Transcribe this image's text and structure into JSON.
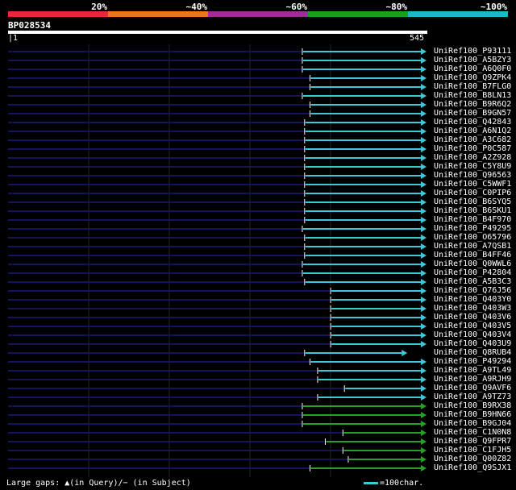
{
  "legend": [
    {
      "label": "20%",
      "color": "#e8283a"
    },
    {
      "label": "~40%",
      "color": "#e8781e"
    },
    {
      "label": "~60%",
      "color": "#9b2e9a"
    },
    {
      "label": "~80%",
      "color": "#1aa01a"
    },
    {
      "label": "~100%",
      "color": "#1ab8c8"
    }
  ],
  "query": {
    "id": "BP028534",
    "start_label": "1",
    "end_label": "545",
    "length": 545
  },
  "colors": {
    "query_gap": "#14145a",
    "cyan": "#3cc8d8",
    "green": "#28a028",
    "grid": "#242424"
  },
  "hits": [
    {
      "label": "UniRef100_P93111",
      "start": 385,
      "end": 545,
      "color": "cyan"
    },
    {
      "label": "UniRef100_A5BZY3",
      "start": 385,
      "end": 545,
      "color": "cyan"
    },
    {
      "label": "UniRef100_A6Q0F0",
      "start": 385,
      "end": 545,
      "color": "cyan"
    },
    {
      "label": "UniRef100_Q9ZPK4",
      "start": 395,
      "end": 545,
      "color": "cyan"
    },
    {
      "label": "UniRef100_B7FLG0",
      "start": 395,
      "end": 545,
      "color": "cyan"
    },
    {
      "label": "UniRef100_B8LN13",
      "start": 385,
      "end": 545,
      "color": "cyan"
    },
    {
      "label": "UniRef100_B9R6Q2",
      "start": 395,
      "end": 545,
      "color": "cyan"
    },
    {
      "label": "UniRef100_B9GN57",
      "start": 395,
      "end": 545,
      "color": "cyan"
    },
    {
      "label": "UniRef100_Q42843",
      "start": 388,
      "end": 545,
      "color": "cyan"
    },
    {
      "label": "UniRef100_A6N1Q2",
      "start": 388,
      "end": 545,
      "color": "cyan"
    },
    {
      "label": "UniRef100_A3C682",
      "start": 388,
      "end": 545,
      "color": "cyan"
    },
    {
      "label": "UniRef100_P0C587",
      "start": 388,
      "end": 545,
      "color": "cyan"
    },
    {
      "label": "UniRef100_A2Z928",
      "start": 388,
      "end": 545,
      "color": "cyan"
    },
    {
      "label": "UniRef100_C5Y8U9",
      "start": 388,
      "end": 545,
      "color": "cyan"
    },
    {
      "label": "UniRef100_Q96563",
      "start": 388,
      "end": 545,
      "color": "cyan"
    },
    {
      "label": "UniRef100_C5WWF1",
      "start": 388,
      "end": 545,
      "color": "cyan"
    },
    {
      "label": "UniRef100_C0PIP6",
      "start": 388,
      "end": 545,
      "color": "cyan"
    },
    {
      "label": "UniRef100_B6SYQ5",
      "start": 388,
      "end": 545,
      "color": "cyan"
    },
    {
      "label": "UniRef100_B6SKU1",
      "start": 388,
      "end": 545,
      "color": "cyan"
    },
    {
      "label": "UniRef100_B4F970",
      "start": 388,
      "end": 545,
      "color": "cyan"
    },
    {
      "label": "UniRef100_P49295",
      "start": 385,
      "end": 545,
      "color": "cyan"
    },
    {
      "label": "UniRef100_O65796",
      "start": 388,
      "end": 545,
      "color": "cyan"
    },
    {
      "label": "UniRef100_A7QSB1",
      "start": 388,
      "end": 545,
      "color": "cyan"
    },
    {
      "label": "UniRef100_B4FF46",
      "start": 388,
      "end": 545,
      "color": "cyan"
    },
    {
      "label": "UniRef100_Q0WWL6",
      "start": 385,
      "end": 545,
      "color": "cyan"
    },
    {
      "label": "UniRef100_P42804",
      "start": 385,
      "end": 545,
      "color": "cyan"
    },
    {
      "label": "UniRef100_A5B3C3",
      "start": 388,
      "end": 545,
      "color": "cyan"
    },
    {
      "label": "UniRef100_Q76J56",
      "start": 422,
      "end": 545,
      "color": "cyan"
    },
    {
      "label": "UniRef100_Q403Y0",
      "start": 422,
      "end": 545,
      "color": "cyan"
    },
    {
      "label": "UniRef100_Q403W3",
      "start": 422,
      "end": 545,
      "color": "cyan"
    },
    {
      "label": "UniRef100_Q403V6",
      "start": 422,
      "end": 545,
      "color": "cyan"
    },
    {
      "label": "UniRef100_Q403V5",
      "start": 422,
      "end": 545,
      "color": "cyan"
    },
    {
      "label": "UniRef100_Q403V4",
      "start": 422,
      "end": 545,
      "color": "cyan"
    },
    {
      "label": "UniRef100_Q403U9",
      "start": 422,
      "end": 545,
      "color": "cyan"
    },
    {
      "label": "UniRef100_Q8RUB4",
      "start": 388,
      "end": 520,
      "color": "cyan"
    },
    {
      "label": "UniRef100_P49294",
      "start": 395,
      "end": 545,
      "color": "cyan"
    },
    {
      "label": "UniRef100_A9TL49",
      "start": 405,
      "end": 545,
      "color": "cyan"
    },
    {
      "label": "UniRef100_A9RJH9",
      "start": 405,
      "end": 545,
      "color": "cyan"
    },
    {
      "label": "UniRef100_Q9AVF6",
      "start": 440,
      "end": 545,
      "color": "cyan"
    },
    {
      "label": "UniRef100_A9TZ73",
      "start": 405,
      "end": 545,
      "color": "cyan"
    },
    {
      "label": "UniRef100_B9RX38",
      "start": 385,
      "end": 545,
      "color": "green"
    },
    {
      "label": "UniRef100_B9HN66",
      "start": 385,
      "end": 545,
      "color": "green"
    },
    {
      "label": "UniRef100_B9GJ04",
      "start": 385,
      "end": 545,
      "color": "green"
    },
    {
      "label": "UniRef100_C1N0N8",
      "start": 438,
      "end": 545,
      "color": "green"
    },
    {
      "label": "UniRef100_Q9FPR7",
      "start": 415,
      "end": 545,
      "color": "green"
    },
    {
      "label": "UniRef100_C1FJH5",
      "start": 438,
      "end": 545,
      "color": "green"
    },
    {
      "label": "UniRef100_Q00Z82",
      "start": 445,
      "end": 545,
      "color": "green"
    },
    {
      "label": "UniRef100_Q9SJX1",
      "start": 395,
      "end": 545,
      "color": "green"
    }
  ],
  "footer": {
    "gaps_text": "Large gaps: ▲(in Query)/− (in Subject)",
    "scale_text": "=100char."
  }
}
